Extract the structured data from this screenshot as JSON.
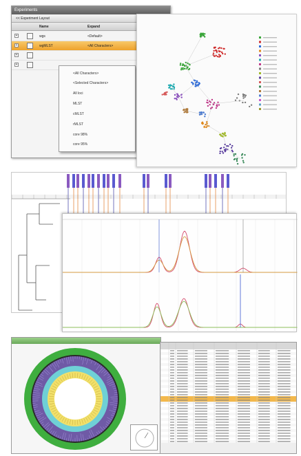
{
  "experiments": {
    "title": "Experiments",
    "toolbar_label": "<< Experiment Layout",
    "columns": {
      "name": "Name",
      "expand": "Expand"
    },
    "rows": [
      {
        "name": "wgs",
        "expand": "<Default>",
        "selected": false
      },
      {
        "name": "wgMLST",
        "expand": "<All Characters>",
        "selected": true
      },
      {
        "name": "",
        "expand": "",
        "selected": false
      },
      {
        "name": "",
        "expand": "",
        "selected": false
      }
    ],
    "dropdown_items": [
      "<All Characters>",
      "<Selected Characters>",
      "All loci",
      "MLST",
      "cMLST",
      "rMLST",
      "core 98%",
      "core 95%"
    ]
  },
  "scatter": {
    "legend_color_count": 17,
    "colors": [
      "#3aa63a",
      "#d03030",
      "#2e6bd8",
      "#e08a1e",
      "#8b4fbf",
      "#1faab0",
      "#c03a8a",
      "#7a7a7a",
      "#a0b82a",
      "#5a3e9e",
      "#d65a5a",
      "#3a8a5a",
      "#b07a3a",
      "#4a7ad0",
      "#cc55cc",
      "#5aa0c8",
      "#9a9a30"
    ]
  },
  "colors": {
    "selection": "#eea22c",
    "ring_green": "#3fae3f",
    "ring_purple": "#6f5aa6",
    "ring_cyan": "#6fd0d6",
    "ring_yellow": "#f1e06a",
    "table_highlight": "#f3b84b"
  }
}
